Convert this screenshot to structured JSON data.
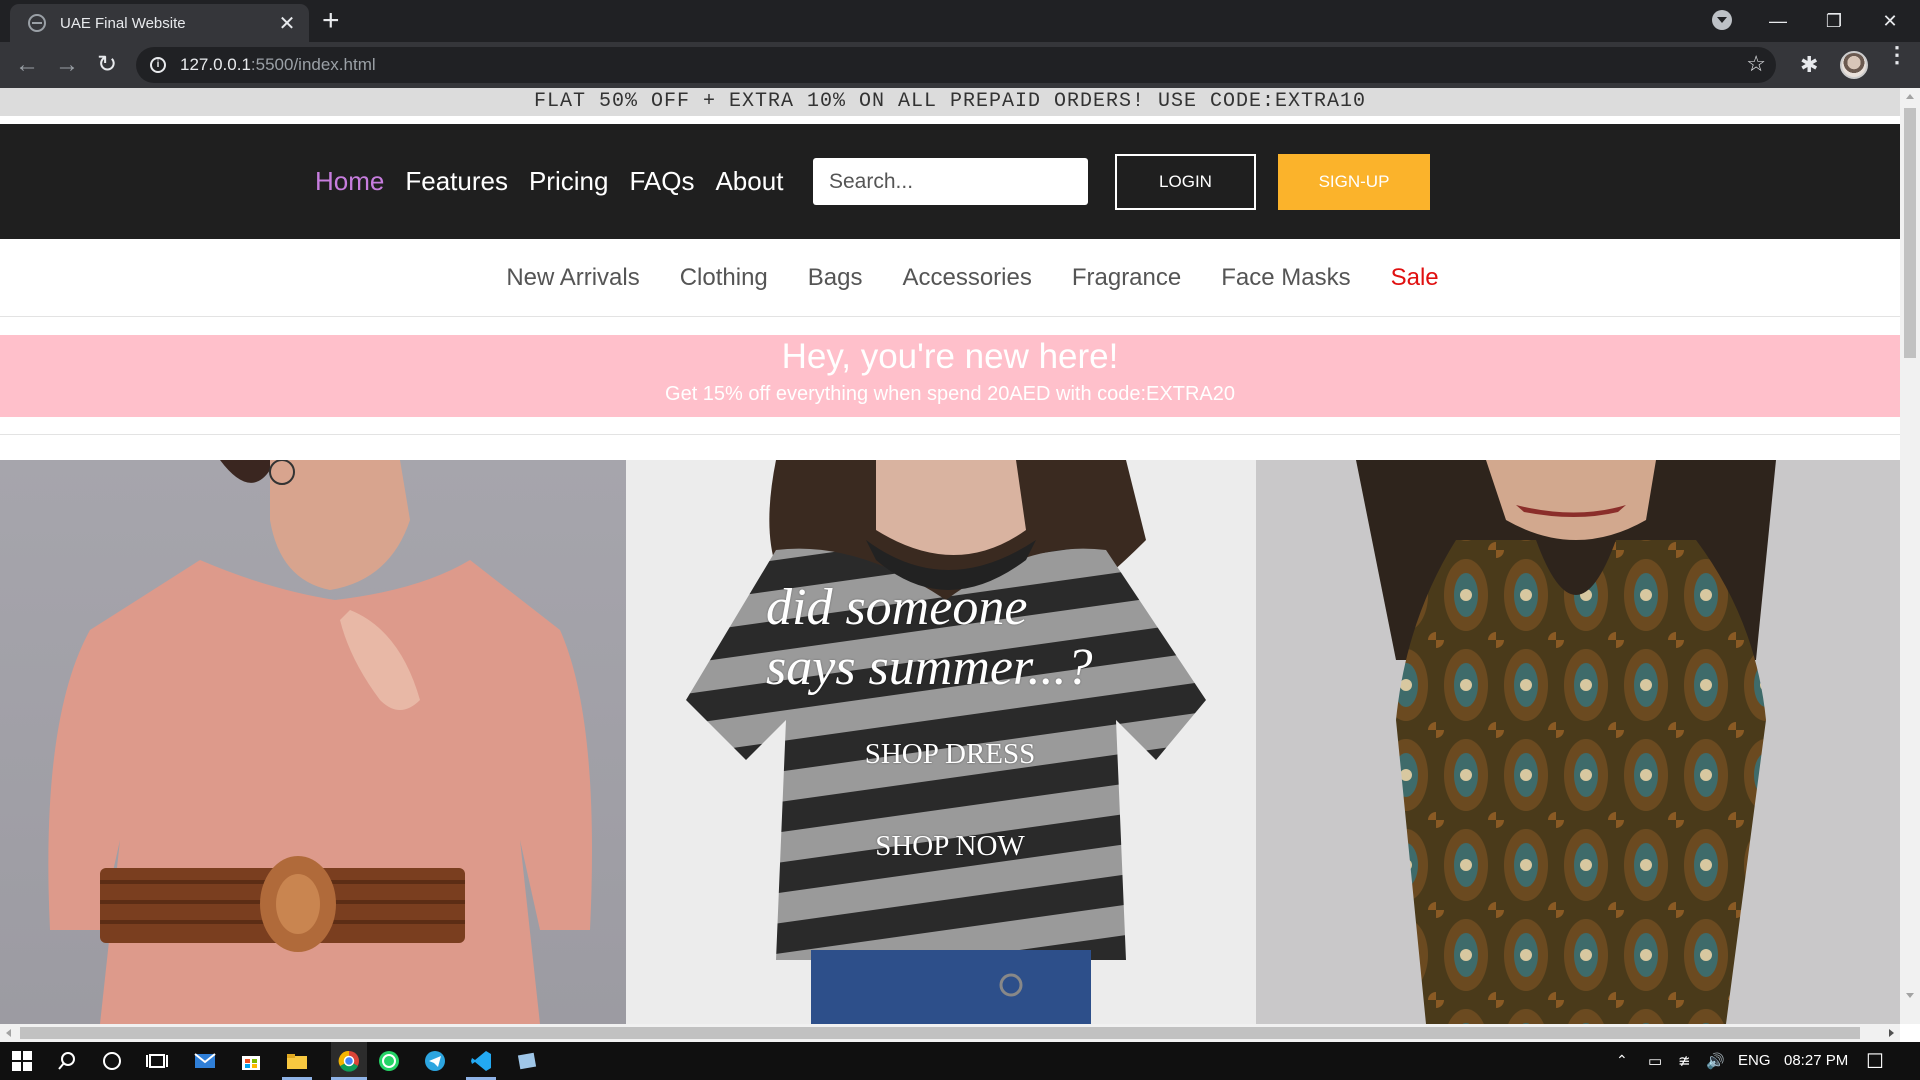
{
  "browser": {
    "tab_title": "UAE Final Website",
    "url_host": "127.0.0.1",
    "url_path": ":5500/index.html"
  },
  "page": {
    "promo": "FLAT 50% OFF + EXTRA 10% ON ALL PREPAID ORDERS! USE CODE:EXTRA10",
    "nav": [
      "Home",
      "Features",
      "Pricing",
      "FAQs",
      "About"
    ],
    "search_placeholder": "Search...",
    "login_label": "LOGIN",
    "signup_label": "SIGN-UP",
    "categories": [
      "New Arrivals",
      "Clothing",
      "Bags",
      "Accessories",
      "Fragrance",
      "Face Masks",
      "Sale"
    ],
    "welcome_title": "Hey, you're new here!",
    "welcome_subtitle": "Get 15% off everything when spend 20AED with code:EXTRA20",
    "hero_line1": "did someone",
    "hero_line2": "says summer...?",
    "hero_cta1": "SHOP DRESS",
    "hero_cta2": "SHOP NOW",
    "colors": {
      "header_bg": "#1f1f1f",
      "nav_active": "#c77dde",
      "signup_bg": "#fbb32b",
      "sale": "#e01010",
      "welcome_bg": "#ffc0cb"
    }
  },
  "taskbar": {
    "lang": "ENG",
    "time": "08:27 PM"
  }
}
